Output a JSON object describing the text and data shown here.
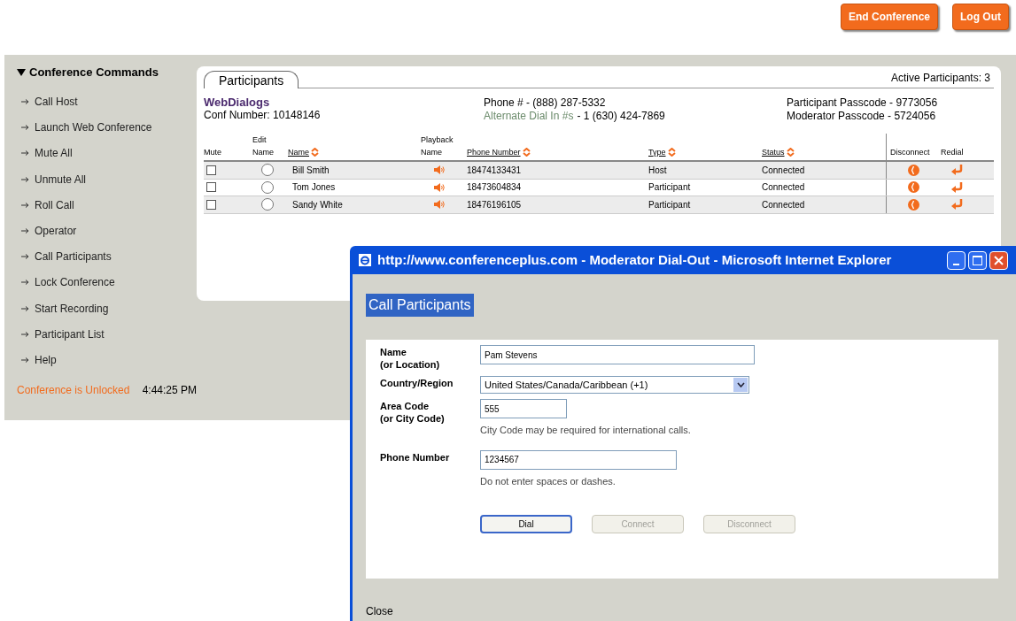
{
  "header": {
    "buttons": [
      "End Conference",
      "Log Out"
    ]
  },
  "sidebar": {
    "title": "Conference Commands",
    "expanded": true,
    "items": [
      "Call Host",
      "Launch Web Conference",
      "Mute All",
      "Unmute All",
      "Roll Call",
      "Operator",
      "Call Participants",
      "Lock Conference",
      "Start Recording",
      "Participant List",
      "Help"
    ],
    "lock_status": "Conference is Unlocked",
    "time": "4:44:25 PM"
  },
  "panel": {
    "tabs": [
      {
        "label": "Participants",
        "selected": true
      }
    ],
    "active_count": "Active Participants: 3",
    "brand": "WebDialogs",
    "conf_number": "Conf Number: 10148146",
    "phone": "Phone # - (888) 287-5332",
    "alt_label": "Alternate Dial In #s",
    "alt_value": "- 1 (630) 424-7869",
    "participant_passcode": "Participant Passcode - 9773056",
    "moderator_passcode": "Moderator Passcode - 5724056",
    "columns": [
      {
        "label": "Mute",
        "sortable": false
      },
      {
        "top": "Edit",
        "label": "Name",
        "sortable": false
      },
      {
        "label": "Name",
        "sortable": true
      },
      {
        "top": "Playback",
        "label": "Name",
        "sortable": false
      },
      {
        "label": "Phone Number",
        "sortable": true
      },
      {
        "label": "Type",
        "sortable": true
      },
      {
        "label": "Status",
        "sortable": true
      },
      {
        "label": "Disconnect",
        "sortable": false
      },
      {
        "label": "Redial",
        "sortable": false
      }
    ],
    "rows": [
      {
        "muted": false,
        "selected": false,
        "name": "Bill Smith",
        "phone": "18474133431",
        "type": "Host",
        "status": "Connected"
      },
      {
        "muted": false,
        "selected": false,
        "name": "Tom Jones",
        "phone": "18473604834",
        "type": "Participant",
        "status": "Connected"
      },
      {
        "muted": false,
        "selected": false,
        "name": "Sandy White",
        "phone": "18476196105",
        "type": "Participant",
        "status": "Connected"
      }
    ]
  },
  "popup": {
    "title": "http://www.conferenceplus.com - Moderator Dial-Out - Microsoft Internet Explorer",
    "heading": "Call Participants",
    "fields": [
      {
        "kind": "text",
        "label": "Name",
        "sublabel": "(or Location)",
        "value": "Pam Stevens"
      },
      {
        "kind": "select",
        "label": "Country/Region",
        "value": "United States/Canada/Caribbean (+1)"
      },
      {
        "kind": "text",
        "label": "Area Code",
        "sublabel": "(or City Code)",
        "value": "555",
        "hint": "City Code may be required for international calls."
      },
      {
        "kind": "text",
        "label": "Phone Number",
        "value": "1234567",
        "hint": "Do not enter spaces or dashes."
      }
    ],
    "buttons": [
      {
        "label": "Dial",
        "disabled": false
      },
      {
        "label": "Connect",
        "disabled": true
      },
      {
        "label": "Disconnect",
        "disabled": true
      }
    ],
    "close": "Close"
  }
}
